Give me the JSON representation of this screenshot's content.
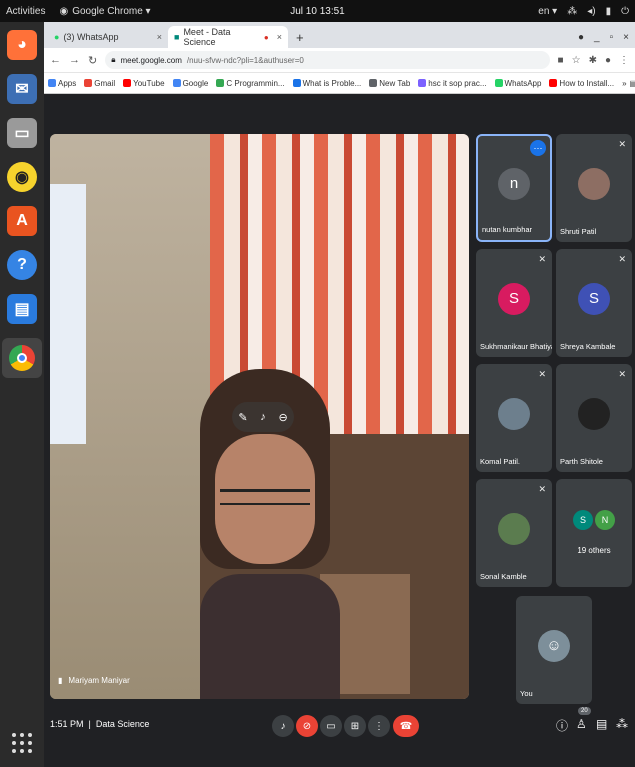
{
  "topbar": {
    "activities": "Activities",
    "app_name": "Google Chrome ▾",
    "clock": "Jul 10  13:51",
    "lang": "en ▾"
  },
  "tabs": [
    {
      "label": "(3) WhatsApp",
      "close": "×"
    },
    {
      "label": "Meet - Data Science",
      "close": "×"
    }
  ],
  "newtab": "+",
  "address": {
    "domain": "meet.google.com",
    "rest": "/nuu-sfvw-ndc?pli=1&authuser=0"
  },
  "bookmarks": [
    {
      "label": "Apps",
      "color": "#4285f4"
    },
    {
      "label": "Gmail",
      "color": "#ea4335"
    },
    {
      "label": "YouTube",
      "color": "#ff0000"
    },
    {
      "label": "Google",
      "color": "#4285f4"
    },
    {
      "label": "C Programmin...",
      "color": "#34a853"
    },
    {
      "label": "What is Proble...",
      "color": "#1a73e8"
    },
    {
      "label": "New Tab",
      "color": "#5f6368"
    },
    {
      "label": "hsc it sop prac...",
      "color": "#7b61ff"
    },
    {
      "label": "WhatsApp",
      "color": "#25d366"
    },
    {
      "label": "How to Install...",
      "color": "#ff0000"
    }
  ],
  "bookmarks_more": "»",
  "reading_list": "Reading list",
  "main_speaker": {
    "name": "Mariyam Maniyar"
  },
  "participants": [
    {
      "name": "nutan kumbhar",
      "initial": "n",
      "color": "#5f6368"
    },
    {
      "name": "Shruti Patil",
      "initial": "",
      "color": "#8d6e63"
    },
    {
      "name": "Sukhmanikaur Bhatiya",
      "initial": "S",
      "color": "#d81b60"
    },
    {
      "name": "Shreya Kambale",
      "initial": "S",
      "color": "#3f51b5"
    },
    {
      "name": "Komal Patil.",
      "initial": "",
      "color": "#6d7f8d"
    },
    {
      "name": "Parth Shitole",
      "initial": "",
      "color": "#222222"
    },
    {
      "name": "Sonal Kamble",
      "initial": "",
      "color": "#5b7c4f"
    }
  ],
  "others": {
    "avatars": [
      "S",
      "N"
    ],
    "colors": [
      "#00897b",
      "#43a047"
    ],
    "label": "19 others"
  },
  "self_tile": {
    "name": "You"
  },
  "bottom": {
    "time": "1:51 PM",
    "separator": "|",
    "meeting": "Data Science",
    "people_count": "20"
  }
}
